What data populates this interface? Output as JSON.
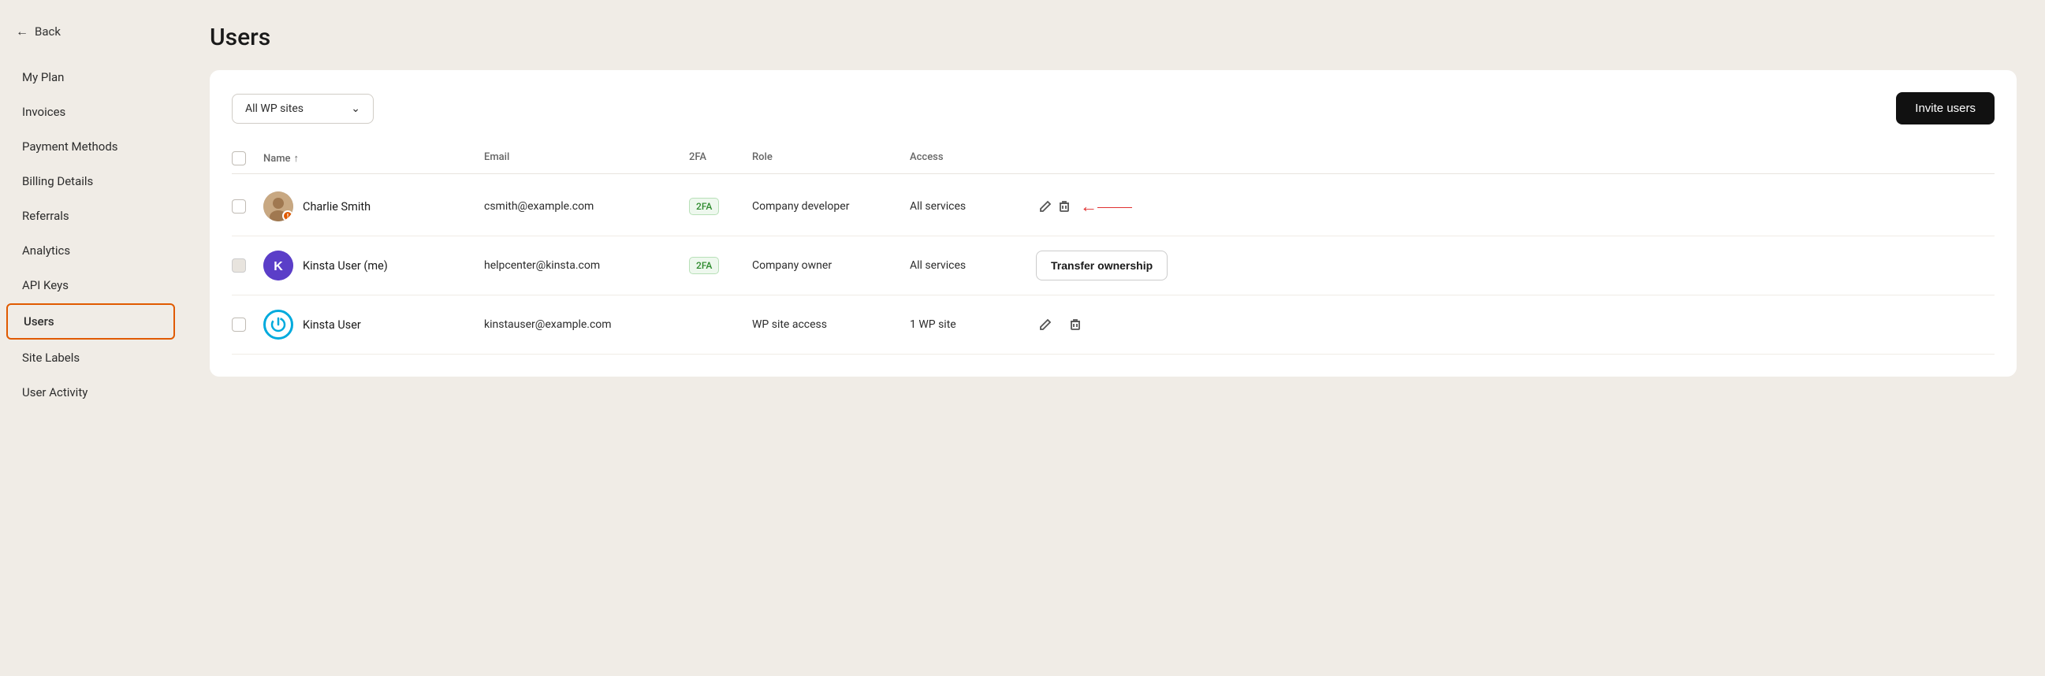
{
  "sidebar": {
    "back_label": "Back",
    "items": [
      {
        "id": "my-plan",
        "label": "My Plan",
        "active": false
      },
      {
        "id": "invoices",
        "label": "Invoices",
        "active": false
      },
      {
        "id": "payment-methods",
        "label": "Payment Methods",
        "active": false
      },
      {
        "id": "billing-details",
        "label": "Billing Details",
        "active": false
      },
      {
        "id": "referrals",
        "label": "Referrals",
        "active": false
      },
      {
        "id": "analytics",
        "label": "Analytics",
        "active": false
      },
      {
        "id": "api-keys",
        "label": "API Keys",
        "active": false
      },
      {
        "id": "users",
        "label": "Users",
        "active": true
      },
      {
        "id": "site-labels",
        "label": "Site Labels",
        "active": false
      },
      {
        "id": "user-activity",
        "label": "User Activity",
        "active": false
      }
    ]
  },
  "page": {
    "title": "Users"
  },
  "toolbar": {
    "dropdown_label": "All WP sites",
    "invite_button": "Invite users"
  },
  "table": {
    "headers": {
      "name": "Name",
      "name_sort": "↑",
      "email": "Email",
      "twofa": "2FA",
      "role": "Role",
      "access": "Access"
    },
    "rows": [
      {
        "id": "charlie",
        "name": "Charlie Smith",
        "email": "csmith@example.com",
        "twofa": "2FA",
        "role": "Company developer",
        "access": "All services",
        "has_edit": true,
        "has_delete": true,
        "has_transfer": false,
        "has_arrow": true,
        "avatar_type": "charlie"
      },
      {
        "id": "kinsta-me",
        "name": "Kinsta User (me)",
        "email": "helpcenter@kinsta.com",
        "twofa": "2FA",
        "role": "Company owner",
        "access": "All services",
        "has_edit": false,
        "has_delete": false,
        "has_transfer": true,
        "has_arrow": false,
        "avatar_type": "kinsta-me",
        "transfer_label": "Transfer ownership"
      },
      {
        "id": "kinsta-user",
        "name": "Kinsta User",
        "email": "kinstauser@example.com",
        "twofa": "",
        "role": "WP site access",
        "access": "1 WP site",
        "has_edit": true,
        "has_delete": true,
        "has_transfer": false,
        "has_arrow": false,
        "avatar_type": "kinsta-power"
      }
    ]
  },
  "colors": {
    "active_border": "#e05a00",
    "invite_bg": "#111111"
  }
}
